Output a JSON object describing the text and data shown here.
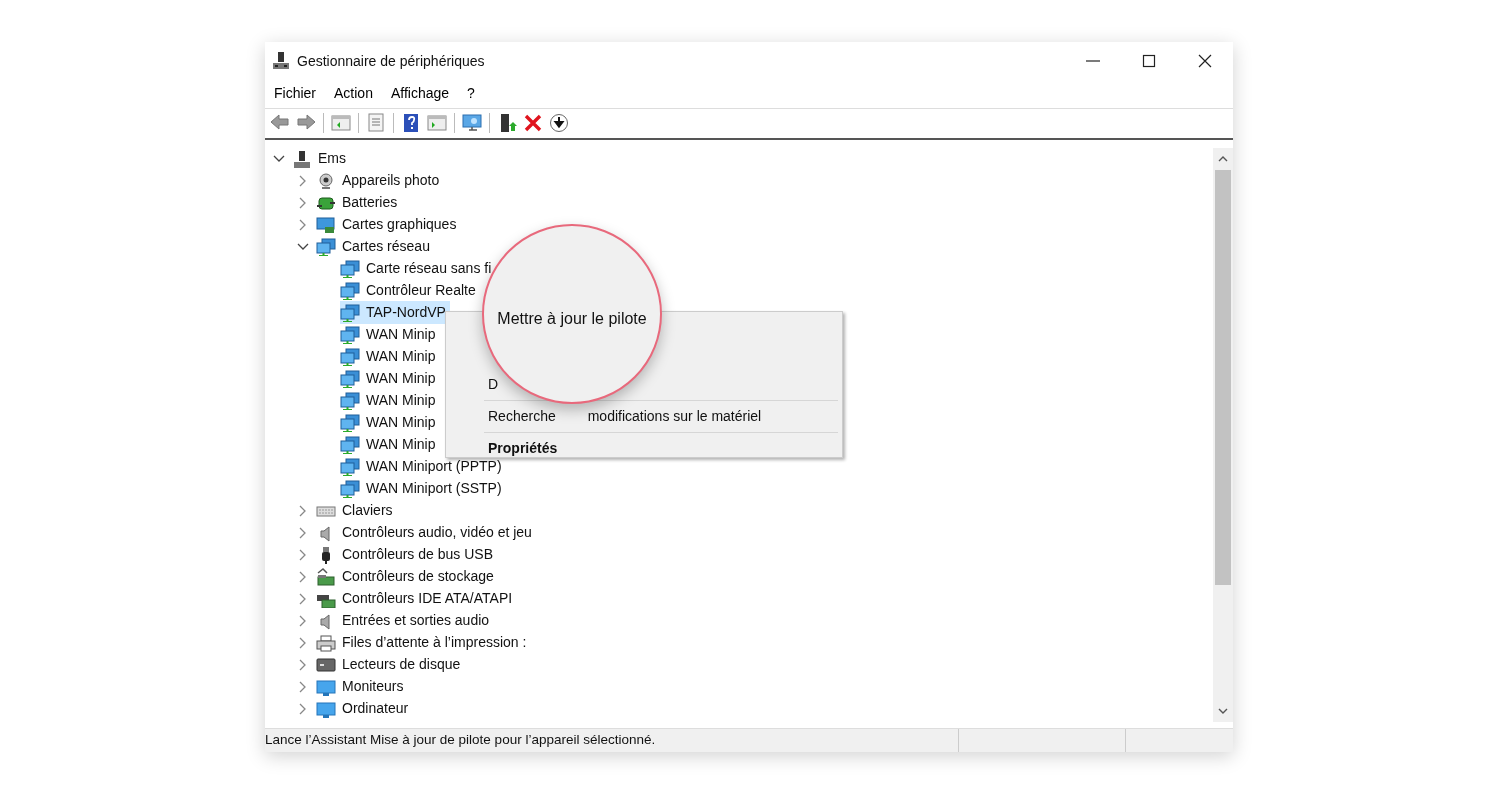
{
  "window": {
    "title": "Gestionnaire de périphériques"
  },
  "menu_bar": [
    "Fichier",
    "Action",
    "Affichage",
    "?"
  ],
  "tree": [
    {
      "label": "Ems",
      "expanded": true,
      "selected": false,
      "children": [
        {
          "label": "Appareils photo",
          "expanded": false,
          "selected": false
        },
        {
          "label": "Batteries",
          "expanded": false,
          "selected": false
        },
        {
          "label": "Cartes graphiques",
          "expanded": false,
          "selected": false
        },
        {
          "label": "Cartes réseau",
          "expanded": true,
          "selected": false,
          "children": [
            {
              "label": "Carte réseau sans fi",
              "selected": false
            },
            {
              "label": "Contrôleur Realte",
              "selected": false
            },
            {
              "label": "TAP-NordVP",
              "selected": true
            },
            {
              "label": "WAN Minip",
              "selected": false
            },
            {
              "label": "WAN Minip",
              "selected": false
            },
            {
              "label": "WAN Minip",
              "selected": false
            },
            {
              "label": "WAN Minip",
              "selected": false
            },
            {
              "label": "WAN Minip",
              "selected": false
            },
            {
              "label": "WAN Minip",
              "selected": false
            },
            {
              "label": "WAN Miniport (PPTP)",
              "selected": false
            },
            {
              "label": "WAN Miniport (SSTP)",
              "selected": false
            }
          ]
        },
        {
          "label": "Claviers",
          "expanded": false,
          "selected": false
        },
        {
          "label": "Contrôleurs audio, vidéo et jeu",
          "expanded": false,
          "selected": false
        },
        {
          "label": "Contrôleurs de bus USB",
          "expanded": false,
          "selected": false
        },
        {
          "label": "Contrôleurs de stockage",
          "expanded": false,
          "selected": false
        },
        {
          "label": "Contrôleurs IDE ATA/ATAPI",
          "expanded": false,
          "selected": false
        },
        {
          "label": "Entrées et sorties audio",
          "expanded": false,
          "selected": false
        },
        {
          "label": "Files d’attente à l’impression :",
          "expanded": false,
          "selected": false
        },
        {
          "label": "Lecteurs de disque",
          "expanded": false,
          "selected": false
        },
        {
          "label": "Moniteurs",
          "expanded": false,
          "selected": false
        },
        {
          "label": "Ordinateur",
          "expanded": false,
          "selected": false
        }
      ]
    }
  ],
  "context_menu": {
    "items": [
      {
        "parts": [
          "D"
        ]
      },
      {
        "parts": [
          "Recherche",
          "modifications sur le matériel"
        ]
      },
      {
        "parts": [
          "Propriétés"
        ],
        "bold": true
      }
    ]
  },
  "magnifier": {
    "text": "Mettre à jour le pilote"
  },
  "status_bar": {
    "text": "Lance l’Assistant Mise à jour de pilote pour l’appareil sélectionné."
  }
}
